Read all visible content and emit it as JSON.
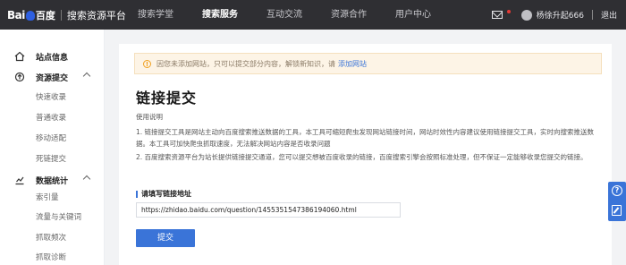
{
  "header": {
    "logo_bai": "Bai",
    "logo_du": "百度",
    "brand": "搜索资源平台",
    "nav": [
      "搜索学堂",
      "搜索服务",
      "互动交流",
      "资源合作",
      "用户中心"
    ],
    "active_nav": "搜索服务",
    "username": "杨徐升起666",
    "logout": "退出"
  },
  "sidebar": {
    "sections": [
      {
        "label": "站点信息",
        "items": []
      },
      {
        "label": "资源提交",
        "items": [
          "快速收录",
          "普通收录",
          "移动适配",
          "死链提交"
        ]
      },
      {
        "label": "数据统计",
        "items": [
          "索引量",
          "流量与关键词",
          "抓取频次",
          "抓取诊断"
        ]
      }
    ]
  },
  "main": {
    "notice_text": "因您未添加网站，只可以提交部分内容，解锁新知识，请",
    "notice_link": "添加网站",
    "title": "链接提交",
    "desc_heading": "使用说明",
    "desc_line1": "1. 链接提交工具是网站主动向百度搜索推送数据的工具，本工具可缩短爬虫发现网站链接时间，网站时效性内容建议使用链接提交工具，实时向搜索推送数",
    "desc_line2": "据。本工具可加快爬虫抓取速度，无法解决网站内容是否收录问题",
    "desc_line3": "2. 百度搜索资源平台为站长提供链接提交通道，您可以提交想被百度收录的链接，百度搜索引擎会按照标准处理，但不保证一定能够收录您提交的链接。",
    "field_label": "请填写链接地址",
    "url_value": "https://zhidao.baidu.com/question/1455351547386194060.html",
    "submit_label": "提交"
  },
  "colors": {
    "accent": "#3a74d8",
    "topbar": "#2f2f33",
    "notice_bg": "#fdf4e6"
  }
}
